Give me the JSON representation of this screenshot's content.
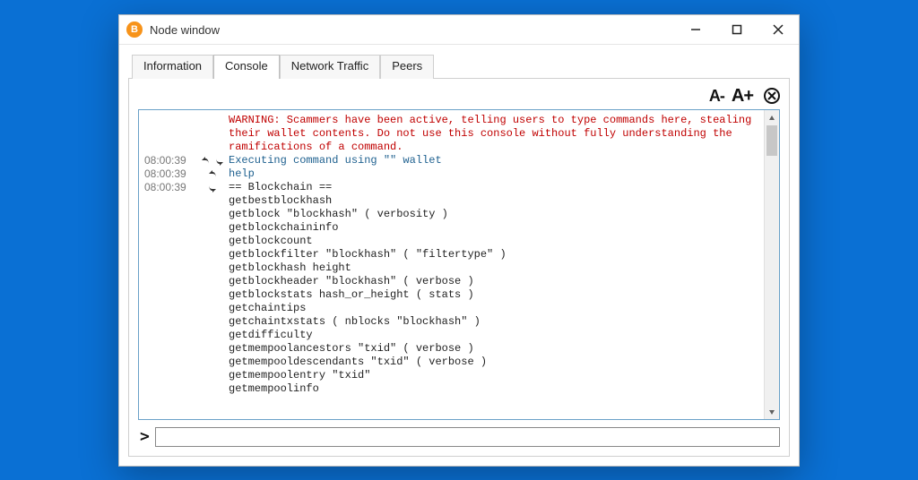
{
  "window": {
    "title": "Node window"
  },
  "tabs": {
    "information": "Information",
    "console": "Console",
    "network": "Network Traffic",
    "peers": "Peers"
  },
  "toolbar": {
    "font_dec": "A-",
    "font_inc": "A+",
    "clear_glyph": "✕"
  },
  "console": {
    "warning": "WARNING: Scammers have been active, telling users to type commands here, stealing their wallet contents. Do not use this console without fully understanding the ramifications of a command.",
    "rows": {
      "0": {
        "ts": "08:00:39",
        "text": "Executing command using \"\" wallet"
      },
      "1": {
        "ts": "08:00:39",
        "text": "help"
      },
      "2": {
        "ts": "08:00:39",
        "text": "== Blockchain ==\ngetbestblockhash\ngetblock \"blockhash\" ( verbosity )\ngetblockchaininfo\ngetblockcount\ngetblockfilter \"blockhash\" ( \"filtertype\" )\ngetblockhash height\ngetblockheader \"blockhash\" ( verbose )\ngetblockstats hash_or_height ( stats )\ngetchaintips\ngetchaintxstats ( nblocks \"blockhash\" )\ngetdifficulty\ngetmempoolancestors \"txid\" ( verbose )\ngetmempooldescendants \"txid\" ( verbose )\ngetmempoolentry \"txid\"\ngetmempoolinfo"
      }
    }
  },
  "input": {
    "prompt": ">",
    "value": "",
    "placeholder": ""
  }
}
